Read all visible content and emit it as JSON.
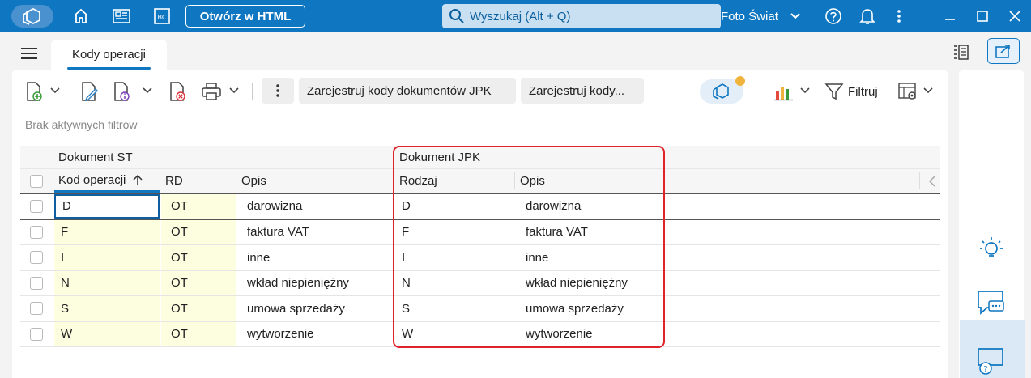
{
  "topbar": {
    "open_html_label": "Otwórz w HTML",
    "search_placeholder": "Wyszukaj (Alt + Q)",
    "company": "Foto Świat"
  },
  "tabs": [
    {
      "label": "Kody operacji"
    }
  ],
  "toolbar": {
    "register_jpk_label": "Zarejestruj kody dokumentów JPK",
    "register_more_label": "Zarejestruj kody...",
    "filter_label": "Filtruj"
  },
  "filters_note": "Brak aktywnych filtrów",
  "grid": {
    "group_headers": {
      "dokument_st": "Dokument ST",
      "dokument_jpk": "Dokument JPK"
    },
    "columns": {
      "kod": "Kod operacji",
      "rd": "RD",
      "opis_st": "Opis",
      "rodzaj": "Rodzaj",
      "opis_jpk": "Opis"
    },
    "rows": [
      {
        "kod": "D",
        "rd": "OT",
        "opis_st": "darowizna",
        "rodzaj": "D",
        "opis_jpk": "darowizna"
      },
      {
        "kod": "F",
        "rd": "OT",
        "opis_st": "faktura VAT",
        "rodzaj": "F",
        "opis_jpk": "faktura VAT"
      },
      {
        "kod": "I",
        "rd": "OT",
        "opis_st": "inne",
        "rodzaj": "I",
        "opis_jpk": "inne"
      },
      {
        "kod": "N",
        "rd": "OT",
        "opis_st": "wkład niepieniężny",
        "rodzaj": "N",
        "opis_jpk": "wkład niepieniężny"
      },
      {
        "kod": "S",
        "rd": "OT",
        "opis_st": "umowa sprzedaży",
        "rodzaj": "S",
        "opis_jpk": "umowa sprzedaży"
      },
      {
        "kod": "W",
        "rd": "OT",
        "opis_st": "wytworzenie",
        "rodzaj": "W",
        "opis_jpk": "wytworzenie"
      }
    ]
  },
  "colors": {
    "brand": "#0f77c1",
    "highlight_border": "#e0232a",
    "editable_cell": "#fdfde0",
    "notification_dot": "#f0b43c"
  }
}
